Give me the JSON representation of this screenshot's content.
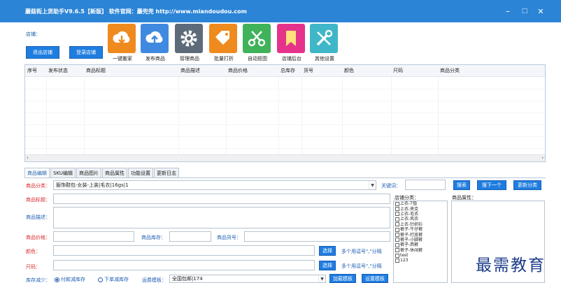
{
  "window": {
    "title": "蘑菇街上货助手V9.6.5【新版】  软件官网：蘑兜兜 http://www.miandoudou.com",
    "minimize": "–",
    "maximize": "□",
    "close": "✕"
  },
  "toolbar": {
    "shop_label": "店铺：",
    "logout_label": "退出店铺",
    "login_label": "登录店铺",
    "tools": [
      {
        "label": "一键搬家",
        "icon": "download-cloud-icon",
        "color": "#ef8a1e"
      },
      {
        "label": "发布商品",
        "icon": "upload-cloud-icon",
        "color": "#3f8ae0"
      },
      {
        "label": "管理商品",
        "icon": "gear-icon",
        "color": "#5d6a7a"
      },
      {
        "label": "批量打折",
        "icon": "price-tag-icon",
        "color": "#ef8a1e"
      },
      {
        "label": "自动抠图",
        "icon": "scissors-icon",
        "color": "#3fb25a"
      },
      {
        "label": "店铺后台",
        "icon": "bookmark-icon",
        "color": "#e5338c"
      },
      {
        "label": "其他设置",
        "icon": "tools-icon",
        "color": "#3fb7c8"
      }
    ]
  },
  "grid": {
    "columns": [
      "序号",
      "发布状态",
      "商品标题",
      "商品描述",
      "商品价格",
      "总库存",
      "货号",
      "颜色",
      "尺码",
      "商品分类"
    ]
  },
  "tabs": [
    "商品编辑",
    "SKU编辑",
    "商品图片",
    "商品属性",
    "功能设置",
    "更新日志"
  ],
  "form": {
    "category_label": "商品分类：",
    "category_value": "服饰鞋包-女装-上装|毛衣|16gs|1",
    "keyword_label": "关键词：",
    "search_label": "搜索",
    "next_label": "搜下一个",
    "update_category_label": "更新分类",
    "title_label": "商品标题：",
    "shop_category_label": "店铺分类：",
    "attribute_label": "商品属性：",
    "desc_label": "商品描述：",
    "price_label": "商品价格：",
    "stock_label": "商品库存：",
    "sku_code_label": "商品货号：",
    "color_label": "颜色：",
    "size_label": "尺码：",
    "select_label": "选择",
    "multi_hint": "多个用逗号\",\"分隔",
    "stock_reduce_label": "库存减少：",
    "radio_pay": "付款减库存",
    "radio_order": "下单减库存",
    "freight_label": "运费模板：",
    "freight_value": "全国包邮|174",
    "load_template_label": "加载模板",
    "set_template_label": "设置模板",
    "shop_categories": [
      "上衣-T恤",
      "上衣-夹克",
      "上衣-毛衣",
      "上衣-风衣",
      "上衣-针织衫",
      "裤子-牛仔裤",
      "裤子-打底裤",
      "裤子-小脚裤",
      "裤子-西裤",
      "裤子-休闲裤",
      "test",
      "123"
    ]
  },
  "watermark": "最需教育"
}
